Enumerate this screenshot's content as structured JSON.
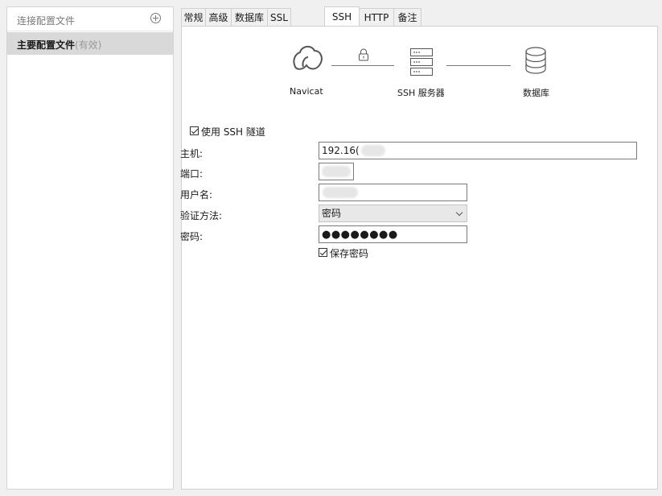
{
  "sidebar": {
    "header_title": "连接配置文件",
    "items": [
      {
        "name": "主要配置文件",
        "status": "(有效)"
      }
    ]
  },
  "tabs": [
    {
      "label": "常规",
      "active": false
    },
    {
      "label": "高级",
      "active": false
    },
    {
      "label": "数据库",
      "active": false
    },
    {
      "label": "SSL",
      "active": false
    },
    {
      "label": "SSH",
      "active": true
    },
    {
      "label": "HTTP",
      "active": false
    },
    {
      "label": "备注",
      "active": false
    }
  ],
  "diagram": {
    "client_label": "Navicat",
    "server_label": "SSH 服务器",
    "database_label": "数据库",
    "client_icon": "navicat-logo-icon",
    "lock_icon": "lock-icon",
    "server_icon": "server-icon",
    "database_icon": "database-icon"
  },
  "ssh": {
    "use_tunnel_label": "使用 SSH 隧道",
    "use_tunnel_checked": true,
    "host_label": "主机:",
    "host_value": "192.16(",
    "port_label": "端口:",
    "port_value": "",
    "username_label": "用户名:",
    "username_value": "",
    "auth_label": "验证方法:",
    "auth_value": "密码",
    "password_label": "密码:",
    "password_mask": "●●●●●●●●",
    "save_password_label": "保存密码",
    "save_password_checked": true
  },
  "colors": {
    "window_bg": "#f0f0f0",
    "panel_bg": "#ffffff",
    "selected_item_bg": "#d9d9d9",
    "border": "#d0d0d0",
    "icon_stroke": "#555555"
  }
}
